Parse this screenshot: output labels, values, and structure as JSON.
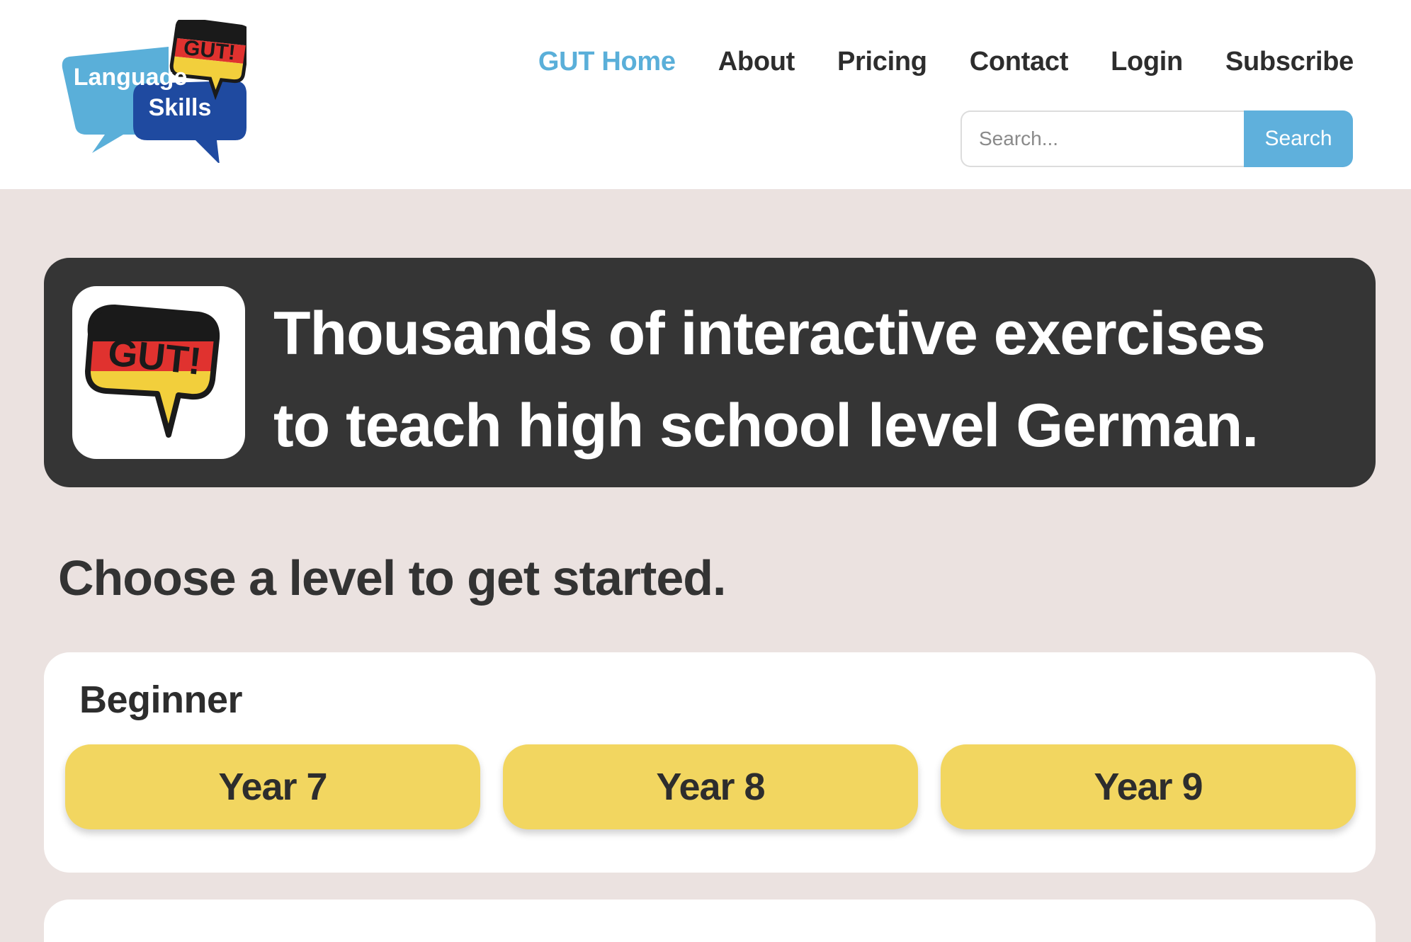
{
  "brand": {
    "logo_line1": "Language",
    "logo_line2": "Skills",
    "logo_badge": "GUT!"
  },
  "nav": {
    "items": [
      {
        "label": "GUT Home",
        "active": true
      },
      {
        "label": "About",
        "active": false
      },
      {
        "label": "Pricing",
        "active": false
      },
      {
        "label": "Contact",
        "active": false
      },
      {
        "label": "Login",
        "active": false
      },
      {
        "label": "Subscribe",
        "active": false
      }
    ]
  },
  "search": {
    "placeholder": "Search...",
    "value": "",
    "button_label": "Search"
  },
  "hero": {
    "icon_text": "GUT!",
    "line1": "Thousands of interactive exercises",
    "line2": "to teach high school level German."
  },
  "main": {
    "heading": "Choose a level to get started.",
    "levels": [
      {
        "title": "Beginner",
        "years": [
          "Year 7",
          "Year 8",
          "Year 9"
        ]
      }
    ]
  },
  "colors": {
    "accent_blue": "#5aafd9",
    "dark_banner": "#353535",
    "page_background": "#ebe2e0",
    "year_button": "#f2d660",
    "flag_black": "#1a1a1a",
    "flag_red": "#e0322f",
    "flag_gold": "#f2cf3c",
    "logo_light_blue": "#5aafd9",
    "logo_dark_blue": "#1f4aa0"
  }
}
